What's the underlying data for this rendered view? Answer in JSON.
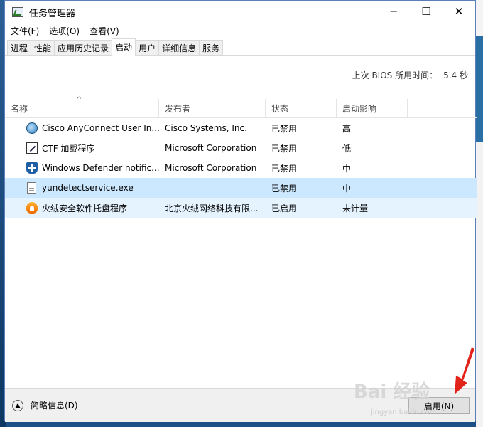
{
  "window": {
    "title": "任务管理器"
  },
  "window_controls": {
    "minimize": "─",
    "maximize": "☐",
    "close": "✕"
  },
  "menu": [
    "文件(F)",
    "选项(O)",
    "查看(V)"
  ],
  "tabs": [
    "进程",
    "性能",
    "应用历史记录",
    "启动",
    "用户",
    "详细信息",
    "服务"
  ],
  "active_tab": "启动",
  "bios": {
    "label": "上次 BIOS 所用时间：",
    "value": "5.4 秒"
  },
  "columns": [
    "名称",
    "发布者",
    "状态",
    "启动影响"
  ],
  "sort_indicator": "^",
  "rows": [
    {
      "icon": "cisco-icon",
      "name": "Cisco AnyConnect User In...",
      "publisher": "Cisco Systems, Inc.",
      "status": "已禁用",
      "impact": "高"
    },
    {
      "icon": "ctf-icon",
      "name": "CTF 加载程序",
      "publisher": "Microsoft Corporation",
      "status": "已禁用",
      "impact": "低"
    },
    {
      "icon": "defender-shield-icon",
      "name": "Windows Defender notific...",
      "publisher": "Microsoft Corporation",
      "status": "已禁用",
      "impact": "中"
    },
    {
      "icon": "file-icon",
      "name": "yundetectservice.exe",
      "publisher": "",
      "status": "已禁用",
      "impact": "中"
    },
    {
      "icon": "huorong-icon",
      "name": "火绒安全软件托盘程序",
      "publisher": "北京火绒网络科技有限...",
      "status": "已启用",
      "impact": "未计量"
    }
  ],
  "footer": {
    "fewer_details": "简略信息(D)",
    "enable_button": "启用(N)"
  },
  "watermark": {
    "main": "Bai 经验",
    "sub": "jingyan.baidu.com"
  },
  "colors": {
    "selected_row": "#cce8ff",
    "hover_row": "#e5f3ff",
    "arrow": "#e2231a"
  }
}
